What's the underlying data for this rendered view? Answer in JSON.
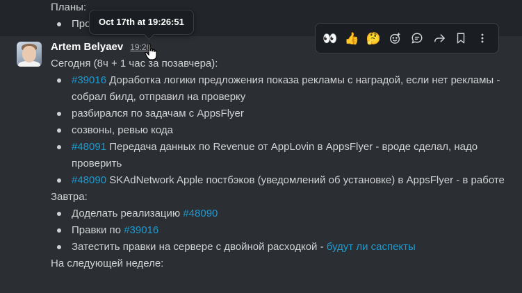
{
  "previous": {
    "heading": "Планы:",
    "bullet": "Про"
  },
  "tooltip": {
    "text": "Oct 17th at 19:26:51"
  },
  "message": {
    "author": "Artem Belyaev",
    "time": "19:26",
    "today_heading": "Сегодня (8ч + 1 час за позавчера):",
    "today_items": [
      {
        "link": "#39016",
        "text": " Доработка логики предложения показа рекламы с наградой, если нет рекламы - собрал билд, отправил на проверку"
      },
      {
        "link": "",
        "text": "разбирался по задачам с AppsFlyer"
      },
      {
        "link": "",
        "text": "созвоны, ревью кода"
      },
      {
        "link": "#48091",
        "text": " Передача данных по Revenue от AppLovin в AppsFlyer - вроде сделал, надо проверить"
      },
      {
        "link": "#48090",
        "text": " SKAdNetwork Apple постбэков (уведомлений об установке) в AppsFlyer - в работе"
      }
    ],
    "tomorrow_heading": "Завтра:",
    "tomorrow_items": [
      {
        "prefix": "Доделать реализацию ",
        "link": "#48090"
      },
      {
        "prefix": "Правки по ",
        "link": "#39016"
      },
      {
        "prefix": "Затестить правки на сервере с двойной расходкой - ",
        "link": "будут ли саспекты"
      }
    ],
    "next_week_heading": "На следующей неделе:"
  },
  "toolbar": {
    "buttons": [
      {
        "name": "eyes-reaction-button",
        "icon": "eyes-icon",
        "glyph": "👀"
      },
      {
        "name": "thumbs-up-reaction-button",
        "icon": "thumbs-up-icon",
        "glyph": "👍"
      },
      {
        "name": "thinking-reaction-button",
        "icon": "thinking-face-icon",
        "glyph": "🤔"
      },
      {
        "name": "add-reaction-button",
        "icon": "add-emoji-icon",
        "glyph": ""
      },
      {
        "name": "reply-thread-button",
        "icon": "thread-icon",
        "glyph": ""
      },
      {
        "name": "forward-button",
        "icon": "forward-icon",
        "glyph": ""
      },
      {
        "name": "save-button",
        "icon": "bookmark-icon",
        "glyph": ""
      },
      {
        "name": "more-actions-button",
        "icon": "more-vertical-icon",
        "glyph": ""
      }
    ]
  },
  "colors": {
    "link": "#1d9bd1",
    "background": "#222529",
    "hover_row": "#2b2e33"
  }
}
